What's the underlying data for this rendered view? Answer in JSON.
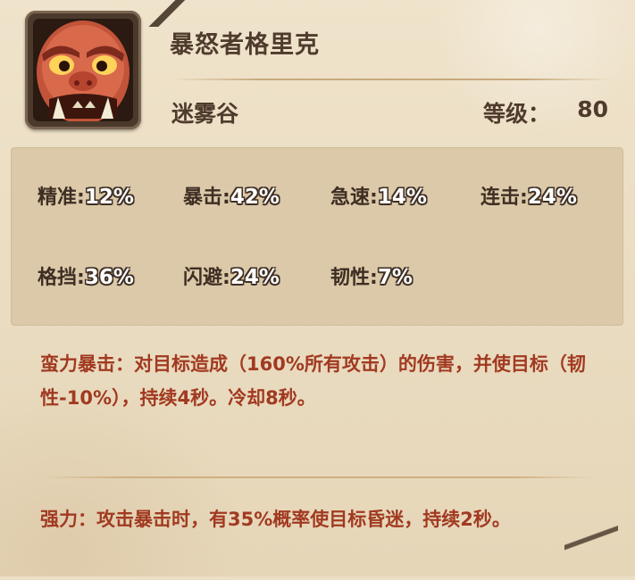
{
  "hero": {
    "name": "暴怒者格里克",
    "location": "迷雾谷",
    "level_label": "等级：",
    "level_value": "80",
    "portrait": "red-ogre-portrait"
  },
  "stats": [
    {
      "label": "精准:",
      "value": "12%"
    },
    {
      "label": "暴击:",
      "value": "42%"
    },
    {
      "label": "急速:",
      "value": "14%"
    },
    {
      "label": "连击:",
      "value": "24%"
    },
    {
      "label": "格挡:",
      "value": "36%"
    },
    {
      "label": "闪避:",
      "value": "24%"
    },
    {
      "label": "韧性:",
      "value": "7%"
    }
  ],
  "skills": [
    {
      "text": "蛮力暴击：对目标造成（160%所有攻击）的伤害，并使目标（韧性-10%），持续4秒。冷却8秒。"
    },
    {
      "text": "强力：攻击暴击时，有35%概率使目标昏迷，持续2秒。"
    }
  ],
  "colors": {
    "background": "#ecdfc6",
    "stats_panel": "#dbc9a9",
    "text_dark": "#4f3b2c",
    "skill_text": "#a13a21"
  }
}
